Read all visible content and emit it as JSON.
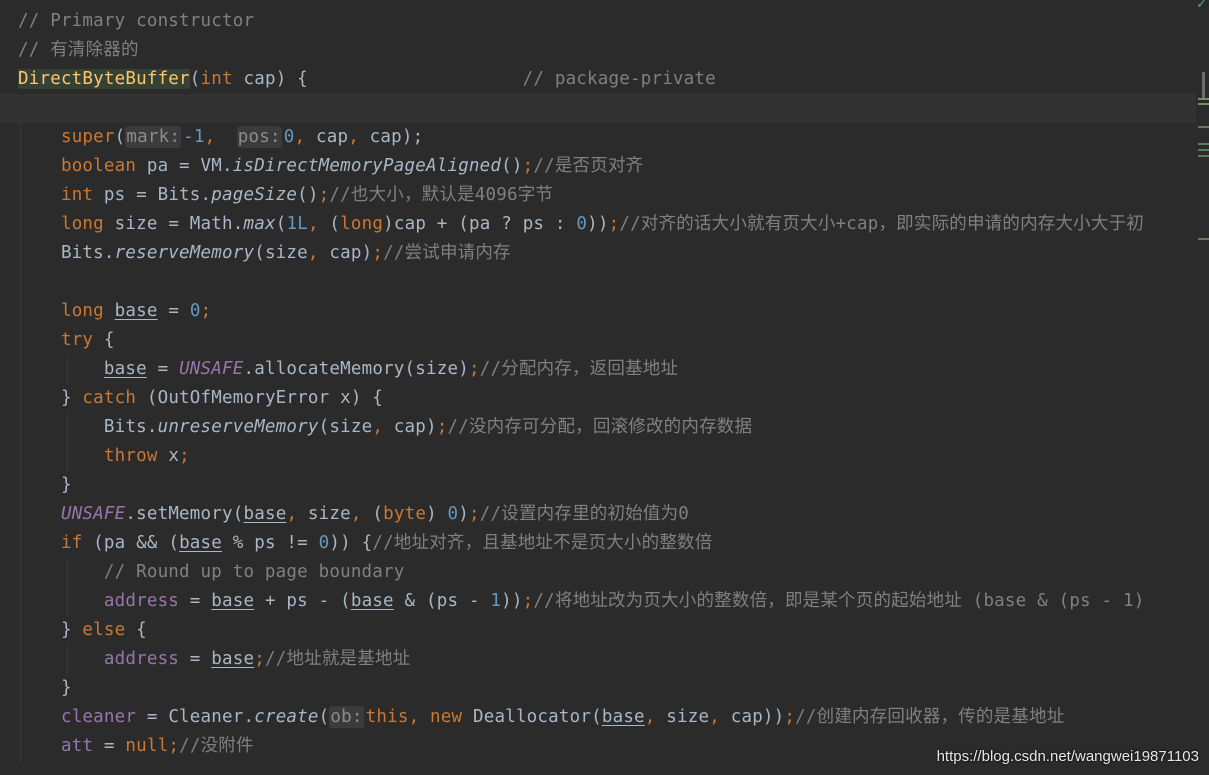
{
  "editor": {
    "status_icon": "check-icon",
    "watermark": "https://blog.csdn.net/wangwei19871103",
    "lines": [
      {
        "tokens": [
          {
            "t": "// Primary constructor",
            "c": "t-comment"
          }
        ]
      },
      {
        "tokens": [
          {
            "t": "// 有清除器的",
            "c": "t-comment"
          }
        ]
      },
      {
        "tokens": [
          {
            "t": "DirectByteBuffer",
            "c": "t-class-hl"
          },
          {
            "t": "(",
            "c": "t-plain"
          },
          {
            "t": "int",
            "c": "t-keyword"
          },
          {
            "t": " cap) {                    ",
            "c": "t-plain"
          },
          {
            "t": "// package-private",
            "c": "t-comment"
          }
        ]
      },
      {
        "caret": true,
        "tokens": []
      },
      {
        "tokens": [
          {
            "t": "    ",
            "c": "t-plain"
          },
          {
            "t": "super",
            "c": "t-keyword"
          },
          {
            "t": "(",
            "c": "t-plain"
          },
          {
            "t": "mark:",
            "c": "hint"
          },
          {
            "t": "-1",
            "c": "t-number"
          },
          {
            "t": ",  ",
            "c": "t-keyword"
          },
          {
            "t": "pos:",
            "c": "hint"
          },
          {
            "t": "0",
            "c": "t-number"
          },
          {
            "t": ", ",
            "c": "t-keyword"
          },
          {
            "t": "cap",
            "c": "t-plain"
          },
          {
            "t": ", ",
            "c": "t-keyword"
          },
          {
            "t": "cap);",
            "c": "t-plain"
          }
        ]
      },
      {
        "tokens": [
          {
            "t": "    ",
            "c": "t-plain"
          },
          {
            "t": "boolean",
            "c": "t-keyword"
          },
          {
            "t": " pa = VM.",
            "c": "t-plain"
          },
          {
            "t": "isDirectMemoryPageAligned",
            "c": "t-method-static"
          },
          {
            "t": "()",
            "c": "t-plain"
          },
          {
            "t": ";",
            "c": "t-keyword"
          },
          {
            "t": "//是否页对齐",
            "c": "t-comment"
          }
        ]
      },
      {
        "tokens": [
          {
            "t": "    ",
            "c": "t-plain"
          },
          {
            "t": "int",
            "c": "t-keyword"
          },
          {
            "t": " ps = Bits.",
            "c": "t-plain"
          },
          {
            "t": "pageSize",
            "c": "t-method-static"
          },
          {
            "t": "()",
            "c": "t-plain"
          },
          {
            "t": ";",
            "c": "t-keyword"
          },
          {
            "t": "//也大小，默认是4096字节",
            "c": "t-comment"
          }
        ]
      },
      {
        "tokens": [
          {
            "t": "    ",
            "c": "t-plain"
          },
          {
            "t": "long",
            "c": "t-keyword"
          },
          {
            "t": " size = Math.",
            "c": "t-plain"
          },
          {
            "t": "max",
            "c": "t-method-static"
          },
          {
            "t": "(",
            "c": "t-plain"
          },
          {
            "t": "1L",
            "c": "t-number"
          },
          {
            "t": ", ",
            "c": "t-keyword"
          },
          {
            "t": "(",
            "c": "t-plain"
          },
          {
            "t": "long",
            "c": "t-keyword"
          },
          {
            "t": ")cap + (pa ? ps : ",
            "c": "t-plain"
          },
          {
            "t": "0",
            "c": "t-number"
          },
          {
            "t": "))",
            "c": "t-plain"
          },
          {
            "t": ";",
            "c": "t-keyword"
          },
          {
            "t": "//对齐的话大小就有页大小+cap，即实际的申请的内存大小大于初",
            "c": "t-comment"
          }
        ]
      },
      {
        "tokens": [
          {
            "t": "    Bits.",
            "c": "t-plain"
          },
          {
            "t": "reserveMemory",
            "c": "t-method-static"
          },
          {
            "t": "(size",
            "c": "t-plain"
          },
          {
            "t": ", ",
            "c": "t-keyword"
          },
          {
            "t": "cap)",
            "c": "t-plain"
          },
          {
            "t": ";",
            "c": "t-keyword"
          },
          {
            "t": "//尝试申请内存",
            "c": "t-comment"
          }
        ]
      },
      {
        "tokens": []
      },
      {
        "tokens": [
          {
            "t": "    ",
            "c": "t-plain"
          },
          {
            "t": "long",
            "c": "t-keyword"
          },
          {
            "t": " ",
            "c": "t-plain"
          },
          {
            "t": "base",
            "c": "t-underline"
          },
          {
            "t": " = ",
            "c": "t-plain"
          },
          {
            "t": "0",
            "c": "t-number"
          },
          {
            "t": ";",
            "c": "t-keyword"
          }
        ]
      },
      {
        "tokens": [
          {
            "t": "    ",
            "c": "t-plain"
          },
          {
            "t": "try",
            "c": "t-keyword"
          },
          {
            "t": " {",
            "c": "t-plain"
          }
        ]
      },
      {
        "tokens": [
          {
            "t": "        ",
            "c": "t-plain"
          },
          {
            "t": "base",
            "c": "t-underline"
          },
          {
            "t": " = ",
            "c": "t-plain"
          },
          {
            "t": "UNSAFE",
            "c": "t-const"
          },
          {
            "t": ".allocateMemory(size)",
            "c": "t-plain"
          },
          {
            "t": ";",
            "c": "t-keyword"
          },
          {
            "t": "//分配内存，返回基地址",
            "c": "t-comment"
          }
        ]
      },
      {
        "tokens": [
          {
            "t": "    } ",
            "c": "t-plain"
          },
          {
            "t": "catch",
            "c": "t-keyword"
          },
          {
            "t": " (OutOfMemoryError x) {",
            "c": "t-plain"
          }
        ]
      },
      {
        "tokens": [
          {
            "t": "        Bits.",
            "c": "t-plain"
          },
          {
            "t": "unreserveMemory",
            "c": "t-method-static"
          },
          {
            "t": "(size",
            "c": "t-plain"
          },
          {
            "t": ", ",
            "c": "t-keyword"
          },
          {
            "t": "cap)",
            "c": "t-plain"
          },
          {
            "t": ";",
            "c": "t-keyword"
          },
          {
            "t": "//没内存可分配，回滚修改的内存数据",
            "c": "t-comment"
          }
        ]
      },
      {
        "tokens": [
          {
            "t": "        ",
            "c": "t-plain"
          },
          {
            "t": "throw",
            "c": "t-keyword"
          },
          {
            "t": " x",
            "c": "t-plain"
          },
          {
            "t": ";",
            "c": "t-keyword"
          }
        ]
      },
      {
        "tokens": [
          {
            "t": "    }",
            "c": "t-plain"
          }
        ]
      },
      {
        "tokens": [
          {
            "t": "    ",
            "c": "t-plain"
          },
          {
            "t": "UNSAFE",
            "c": "t-const"
          },
          {
            "t": ".setMemory(",
            "c": "t-plain"
          },
          {
            "t": "base",
            "c": "t-underline"
          },
          {
            "t": ", ",
            "c": "t-keyword"
          },
          {
            "t": "size",
            "c": "t-plain"
          },
          {
            "t": ", ",
            "c": "t-keyword"
          },
          {
            "t": "(",
            "c": "t-plain"
          },
          {
            "t": "byte",
            "c": "t-keyword"
          },
          {
            "t": ") ",
            "c": "t-plain"
          },
          {
            "t": "0",
            "c": "t-number"
          },
          {
            "t": ")",
            "c": "t-plain"
          },
          {
            "t": ";",
            "c": "t-keyword"
          },
          {
            "t": "//设置内存里的初始值为0",
            "c": "t-comment"
          }
        ]
      },
      {
        "tokens": [
          {
            "t": "    ",
            "c": "t-plain"
          },
          {
            "t": "if",
            "c": "t-keyword"
          },
          {
            "t": " (pa && (",
            "c": "t-plain"
          },
          {
            "t": "base",
            "c": "t-underline"
          },
          {
            "t": " % ps != ",
            "c": "t-plain"
          },
          {
            "t": "0",
            "c": "t-number"
          },
          {
            "t": ")) {",
            "c": "t-plain"
          },
          {
            "t": "//地址对齐，且基地址不是页大小的整数倍",
            "c": "t-comment"
          }
        ]
      },
      {
        "tokens": [
          {
            "t": "        ",
            "c": "t-plain"
          },
          {
            "t": "// Round up to page boundary",
            "c": "t-comment"
          }
        ]
      },
      {
        "tokens": [
          {
            "t": "        ",
            "c": "t-plain"
          },
          {
            "t": "address",
            "c": "t-field"
          },
          {
            "t": " = ",
            "c": "t-plain"
          },
          {
            "t": "base",
            "c": "t-underline"
          },
          {
            "t": " + ps - (",
            "c": "t-plain"
          },
          {
            "t": "base",
            "c": "t-underline"
          },
          {
            "t": " & (ps - ",
            "c": "t-plain"
          },
          {
            "t": "1",
            "c": "t-number"
          },
          {
            "t": "))",
            "c": "t-plain"
          },
          {
            "t": ";",
            "c": "t-keyword"
          },
          {
            "t": "//将地址改为页大小的整数倍，即是某个页的起始地址 (base & (ps - 1)",
            "c": "t-comment"
          }
        ]
      },
      {
        "tokens": [
          {
            "t": "    } ",
            "c": "t-plain"
          },
          {
            "t": "else",
            "c": "t-keyword"
          },
          {
            "t": " {",
            "c": "t-plain"
          }
        ]
      },
      {
        "tokens": [
          {
            "t": "        ",
            "c": "t-plain"
          },
          {
            "t": "address",
            "c": "t-field"
          },
          {
            "t": " = ",
            "c": "t-plain"
          },
          {
            "t": "base",
            "c": "t-underline"
          },
          {
            "t": ";",
            "c": "t-keyword"
          },
          {
            "t": "//地址就是基地址",
            "c": "t-comment"
          }
        ]
      },
      {
        "tokens": [
          {
            "t": "    }",
            "c": "t-plain"
          }
        ]
      },
      {
        "tokens": [
          {
            "t": "    ",
            "c": "t-plain"
          },
          {
            "t": "cleaner",
            "c": "t-field"
          },
          {
            "t": " = Cleaner.",
            "c": "t-plain"
          },
          {
            "t": "create",
            "c": "t-method-static"
          },
          {
            "t": "(",
            "c": "t-plain"
          },
          {
            "t": "ob:",
            "c": "hint"
          },
          {
            "t": "this",
            "c": "t-keyword"
          },
          {
            "t": ", ",
            "c": "t-keyword"
          },
          {
            "t": "new",
            "c": "t-keyword"
          },
          {
            "t": " Deallocator(",
            "c": "t-plain"
          },
          {
            "t": "base",
            "c": "t-underline"
          },
          {
            "t": ", ",
            "c": "t-keyword"
          },
          {
            "t": "size",
            "c": "t-plain"
          },
          {
            "t": ", ",
            "c": "t-keyword"
          },
          {
            "t": "cap))",
            "c": "t-plain"
          },
          {
            "t": ";",
            "c": "t-keyword"
          },
          {
            "t": "//创建内存回收器，传的是基地址",
            "c": "t-comment"
          }
        ]
      },
      {
        "tokens": [
          {
            "t": "    ",
            "c": "t-plain"
          },
          {
            "t": "att",
            "c": "t-field"
          },
          {
            "t": " = ",
            "c": "t-plain"
          },
          {
            "t": "null",
            "c": "t-keyword"
          },
          {
            "t": ";",
            "c": "t-keyword"
          },
          {
            "t": "//没附件",
            "c": "t-comment"
          }
        ]
      }
    ]
  }
}
